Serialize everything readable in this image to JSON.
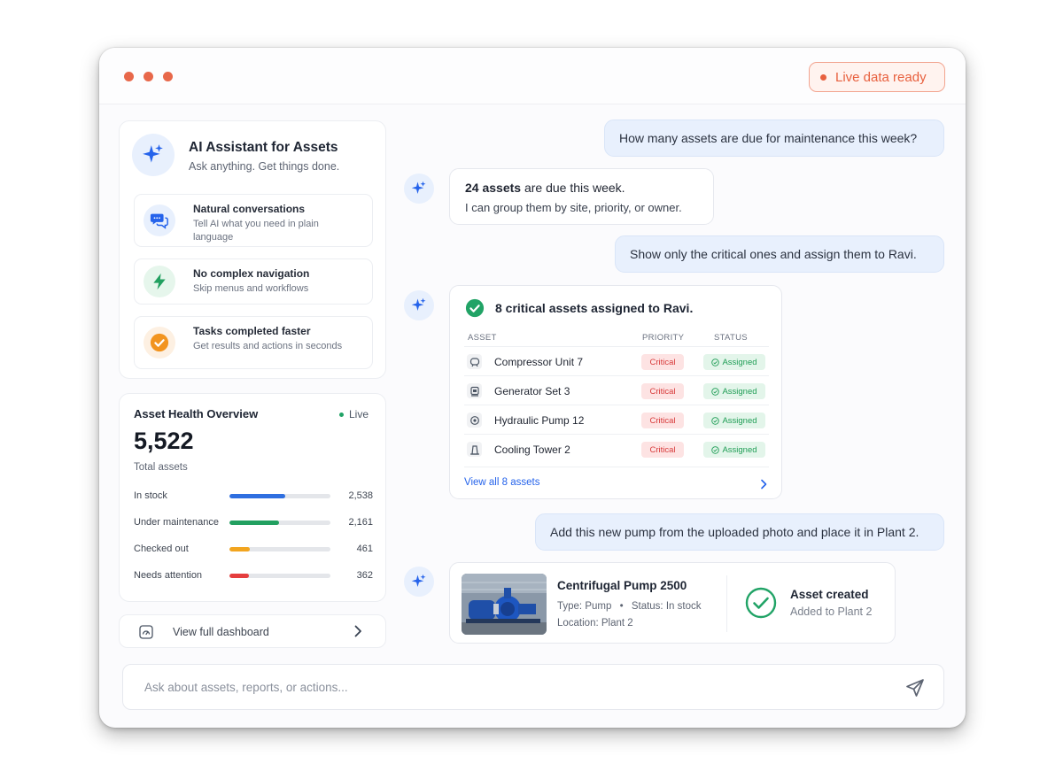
{
  "titlebar": {
    "status_pill": "Live data ready"
  },
  "assistant": {
    "title": "AI Assistant for Assets",
    "subtitle": "Ask anything. Get things done.",
    "features": [
      {
        "title": "Natural conversations",
        "desc": "Tell AI what you need in plain language",
        "icon": "chat-bubbles-icon",
        "color": "#2563eb"
      },
      {
        "title": "No complex navigation",
        "desc": "Skip menus and workflows",
        "icon": "lightning-icon",
        "color": "#22a060"
      },
      {
        "title": "Tasks completed faster",
        "desc": "Get results and actions in seconds",
        "icon": "check-circle-icon",
        "color": "#f2941f"
      }
    ]
  },
  "health": {
    "title": "Asset Health Overview",
    "live_label": "Live",
    "total": "5,522",
    "total_label": "Total assets",
    "rows": [
      {
        "label": "In stock",
        "value": "2,538",
        "fraction": 0.55,
        "color": "#2f6fe0"
      },
      {
        "label": "Under maintenance",
        "value": "2,161",
        "fraction": 0.49,
        "color": "#22a060"
      },
      {
        "label": "Checked out",
        "value": "461",
        "fraction": 0.2,
        "color": "#f2a51f"
      },
      {
        "label": "Needs attention",
        "value": "362",
        "fraction": 0.19,
        "color": "#e53e3e"
      }
    ],
    "dashboard_link": "View full dashboard"
  },
  "chat": {
    "q1": "How many assets are due for maintenance this week?",
    "a1_bold": "24 assets",
    "a1_rest": " are due this week.",
    "a1_line2": "I can group them by site, priority, or owner.",
    "q2": "Show only the critical ones and assign them to Ravi.",
    "a2_title": "8 critical assets assigned to Ravi.",
    "table_headers": {
      "asset": "ASSET",
      "priority": "PRIORITY",
      "status": "STATUS"
    },
    "table_rows": [
      {
        "name": "Compressor Unit 7",
        "priority": "Critical",
        "status": "Assigned",
        "icon": "compressor-icon"
      },
      {
        "name": "Generator Set 3",
        "priority": "Critical",
        "status": "Assigned",
        "icon": "generator-icon"
      },
      {
        "name": "Hydraulic Pump 12",
        "priority": "Critical",
        "status": "Assigned",
        "icon": "pump-icon"
      },
      {
        "name": "Cooling Tower 2",
        "priority": "Critical",
        "status": "Assigned",
        "icon": "cooling-tower-icon"
      }
    ],
    "view_all": "View all 8 assets",
    "q3": "Add this new pump from the uploaded photo and place it in Plant 2.",
    "a3": {
      "product_name": "Centrifugal Pump 2500",
      "type_label": "Type:",
      "type_value": "Pump",
      "status_label": "Status:",
      "status_value": "In stock",
      "location_label": "Location:",
      "location_value": "Plant 2",
      "created_title": "Asset created",
      "created_sub": "Added to Plant 2"
    }
  },
  "composer": {
    "placeholder": "Ask about assets, reports, or actions..."
  }
}
